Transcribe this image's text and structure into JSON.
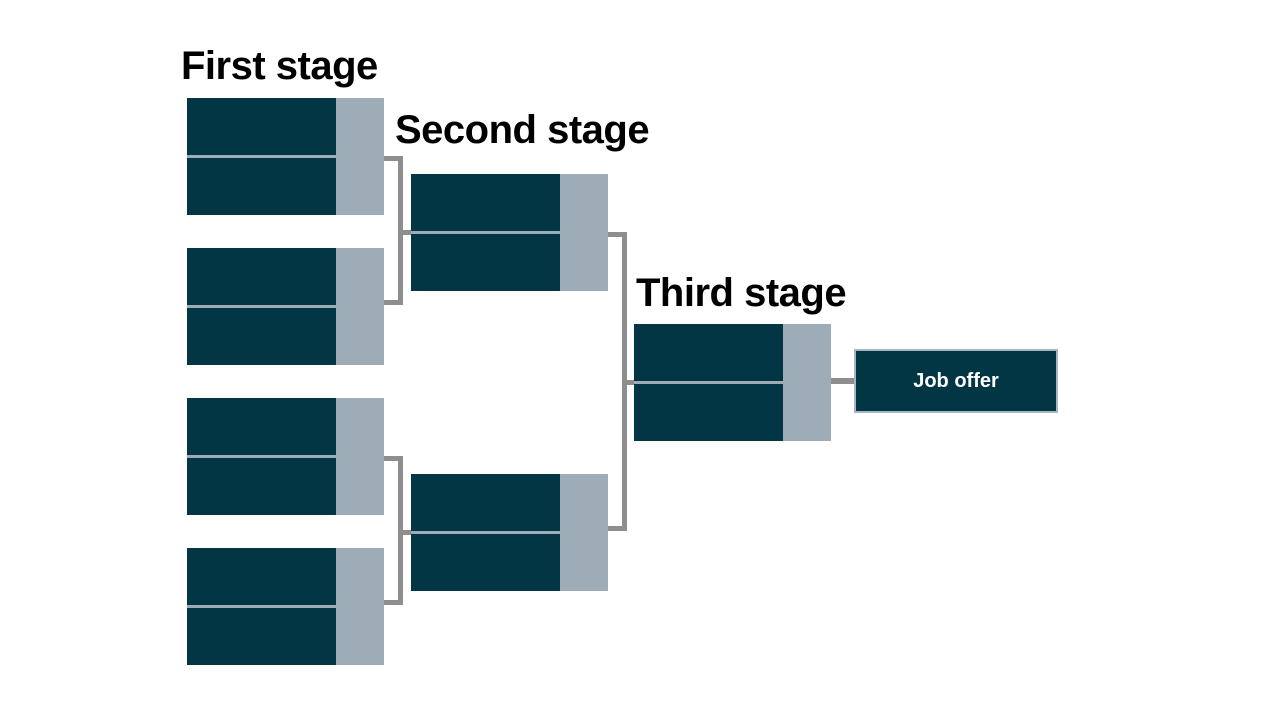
{
  "stages": [
    {
      "title": "First stage"
    },
    {
      "title": "Second stage"
    },
    {
      "title": "Third stage"
    }
  ],
  "result": {
    "label": "Job offer"
  },
  "colors": {
    "slot": "#023645",
    "score": "#9eacb8",
    "connector": "#8e8e8e"
  }
}
